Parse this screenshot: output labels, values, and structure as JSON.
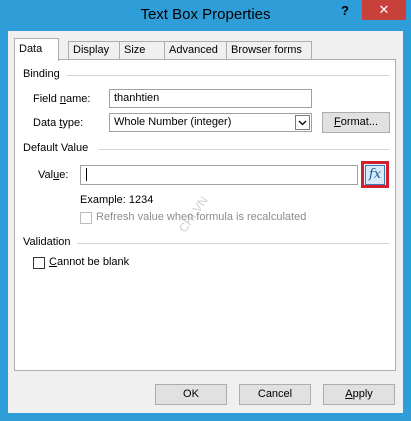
{
  "window": {
    "title": "Text Box Properties",
    "help_label": "?",
    "close_label": "✕"
  },
  "tabs": [
    {
      "label": "Data",
      "active": true
    },
    {
      "label": "Display",
      "active": false
    },
    {
      "label": "Size",
      "active": false
    },
    {
      "label": "Advanced",
      "active": false
    },
    {
      "label": "Browser forms",
      "active": false
    }
  ],
  "binding": {
    "group_label": "Binding",
    "field_name_label": "Field name:",
    "field_name_value": "thanhtien",
    "data_type_label": "Data type:",
    "data_type_value": "Whole Number (integer)",
    "format_button": "Format..."
  },
  "default_value": {
    "group_label": "Default Value",
    "value_label": "Value:",
    "value": "",
    "fx_icon": "fx-formula-icon",
    "fx_label": "fx",
    "example_text": "Example: 1234",
    "refresh_label": "Refresh value when formula is recalculated",
    "refresh_checked": false
  },
  "validation": {
    "group_label": "Validation",
    "cannot_be_blank_label": "Cannot be blank",
    "cannot_be_blank_checked": false
  },
  "watermark": "CHI.VN",
  "footer": {
    "ok": "OK",
    "cancel": "Cancel",
    "apply": "Apply"
  },
  "colors": {
    "title_bar": "#2f9ed8",
    "close_button": "#c7403a",
    "fx_highlight": "#d3202f"
  }
}
